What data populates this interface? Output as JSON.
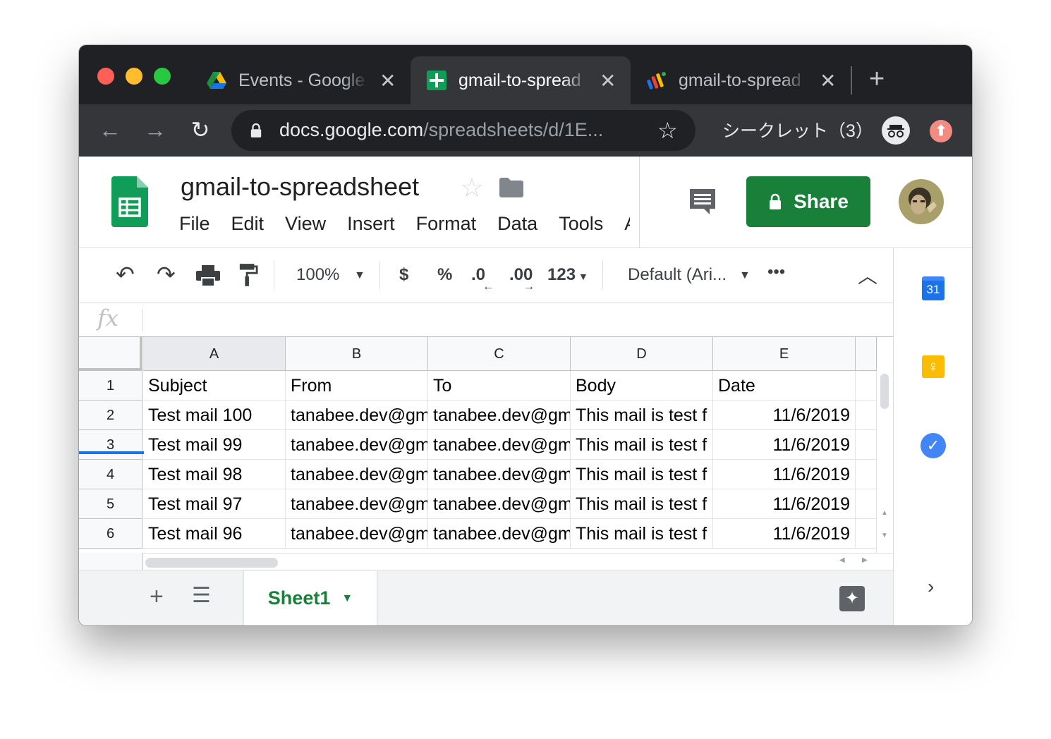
{
  "browser": {
    "tabs": [
      {
        "title": "Events - Google",
        "active": false
      },
      {
        "title": "gmail-to-spread",
        "active": true
      },
      {
        "title": "gmail-to-spread",
        "active": false
      }
    ],
    "url_host": "docs.google.com",
    "url_path": "/spreadsheets/d/1E...",
    "incognito_label": "シークレット（3）"
  },
  "app": {
    "doc_title": "gmail-to-spreadsheet",
    "menu": [
      "File",
      "Edit",
      "View",
      "Insert",
      "Format",
      "Data",
      "Tools",
      "A"
    ],
    "share_label": "Share"
  },
  "toolbar": {
    "zoom": "100%",
    "currency": "$",
    "percent": "%",
    "dec_decrease": ".0",
    "dec_increase": ".00",
    "more_formats": "123",
    "font": "Default (Ari...",
    "more": "•••"
  },
  "formula": {
    "fx_label": "fx"
  },
  "sheet": {
    "columns": [
      "A",
      "B",
      "C",
      "D",
      "E"
    ],
    "row_numbers": [
      "1",
      "2",
      "3",
      "4",
      "5",
      "6"
    ],
    "rows": [
      [
        "Subject",
        "From",
        "To",
        "Body",
        "Date"
      ],
      [
        "Test mail 100",
        "tanabee.dev@gm",
        "tanabee.dev@gm",
        "This mail is test f",
        "11/6/2019"
      ],
      [
        "Test mail 99",
        "tanabee.dev@gm",
        "tanabee.dev@gm",
        "This mail is test f",
        "11/6/2019"
      ],
      [
        "Test mail 98",
        "tanabee.dev@gm",
        "tanabee.dev@gm",
        "This mail is test f",
        "11/6/2019"
      ],
      [
        "Test mail 97",
        "tanabee.dev@gm",
        "tanabee.dev@gm",
        "This mail is test f",
        "11/6/2019"
      ],
      [
        "Test mail 96",
        "tanabee.dev@gm",
        "tanabee.dev@gm",
        "This mail is test f",
        "11/6/2019"
      ]
    ],
    "tab_name": "Sheet1"
  },
  "sidepanel": {
    "calendar_day": "31"
  },
  "colors": {
    "accent_green": "#188038",
    "sheets_green": "#0f9d58",
    "chrome_dark": "#202124",
    "chrome_toolbar": "#35363a",
    "selection_blue": "#1a73e8"
  }
}
